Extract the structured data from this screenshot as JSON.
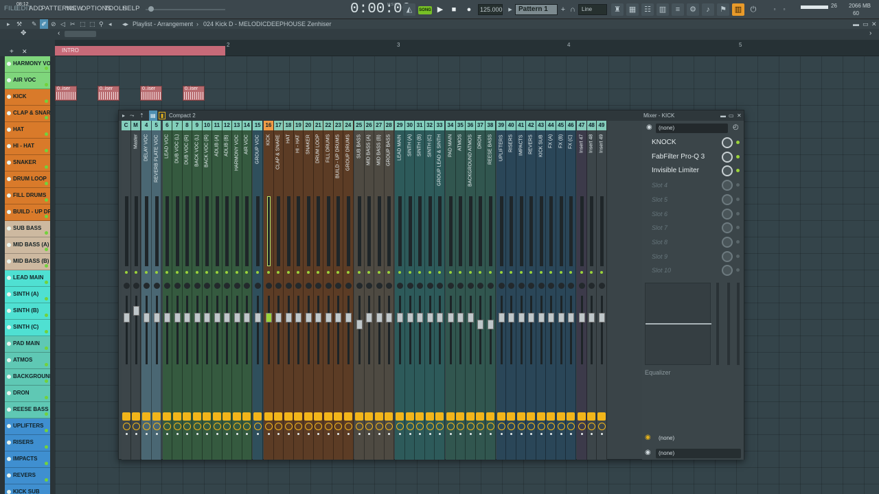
{
  "topbar": {
    "menus": [
      "FILE",
      "EDIT",
      "ADD",
      "PATTERNS",
      "VIEW",
      "OPTIONS",
      "TOOLS",
      "HELP"
    ],
    "time_small": "08:12",
    "time_display": "0:00:00",
    "time_format": "M:S:CS",
    "song_label": "SONG",
    "tempo": "125.000",
    "pattern": "Pattern 1",
    "snap": "Line",
    "ram": "2066 MB",
    "cpu_a": "26",
    "cpu_b": "60"
  },
  "crumb": {
    "title": "Playlist - Arrangement",
    "sep": "›",
    "item": "024 Kick D - MELODICDEEPHOUSE Zenhiser"
  },
  "timeline": {
    "bar_numbers": [
      "2",
      "3",
      "4",
      "5"
    ],
    "marker": "INTRO"
  },
  "tracks": [
    {
      "name": "HARMONY VOC",
      "color": "#7fd67c"
    },
    {
      "name": "AIR VOC",
      "color": "#7fd67c"
    },
    {
      "name": "KICK",
      "color": "#d97a2a"
    },
    {
      "name": "CLAP & SNARE",
      "color": "#d97a2a"
    },
    {
      "name": "HAT",
      "color": "#d97a2a"
    },
    {
      "name": "HI - HAT",
      "color": "#d97a2a"
    },
    {
      "name": "SNAKER",
      "color": "#d97a2a"
    },
    {
      "name": "DRUM LOOP",
      "color": "#d97a2a"
    },
    {
      "name": "FILL DRUMS",
      "color": "#d97a2a"
    },
    {
      "name": "BUILD - UP DR..",
      "color": "#d97a2a"
    },
    {
      "name": "SUB BASS",
      "color": "#cdb9a0"
    },
    {
      "name": "MID BASS (A)",
      "color": "#cdb9a0"
    },
    {
      "name": "MID BASS (B)",
      "color": "#cdb9a0"
    },
    {
      "name": "LEAD MAIN",
      "color": "#4fe0d2"
    },
    {
      "name": "SINTH (A)",
      "color": "#4fe0d2"
    },
    {
      "name": "SINTH (B)",
      "color": "#4fe0d2"
    },
    {
      "name": "SINTH (C)",
      "color": "#4fe0d2"
    },
    {
      "name": "PAD MAIN",
      "color": "#5fc8b4"
    },
    {
      "name": "ATMOS",
      "color": "#5fc8b4"
    },
    {
      "name": "BACKGROUND..",
      "color": "#5fc8b4"
    },
    {
      "name": "DRON",
      "color": "#5fc8b4"
    },
    {
      "name": "REESE BASS",
      "color": "#5fc8b4"
    },
    {
      "name": "UPLIFTERS",
      "color": "#3f8fd0"
    },
    {
      "name": "RISERS",
      "color": "#3f8fd0"
    },
    {
      "name": "IMPACTS",
      "color": "#3f8fd0"
    },
    {
      "name": "REVERS",
      "color": "#3f8fd0"
    },
    {
      "name": "KICK SUB",
      "color": "#3f8fd0"
    }
  ],
  "clips": [
    {
      "label": "0..iser"
    },
    {
      "label": "0..iser"
    },
    {
      "label": "0..iser"
    },
    {
      "label": "0..iser"
    }
  ],
  "mixer": {
    "view": "Compact 2",
    "title": "Mixer - KICK",
    "strips": [
      {
        "num": "C",
        "name": "",
        "color": "#3c4549"
      },
      {
        "num": "M",
        "name": "Master",
        "color": "#3c4549"
      },
      {
        "num": "4",
        "name": "DELAY VOC",
        "color": "#4a6773"
      },
      {
        "num": "5",
        "name": "REVERB PLATE VOC",
        "color": "#4a6773"
      },
      {
        "num": "6",
        "name": "LEAD VOC",
        "color": "#355a3f"
      },
      {
        "num": "7",
        "name": "DUB VOC (L)",
        "color": "#355a3f"
      },
      {
        "num": "8",
        "name": "DUB VOC (R)",
        "color": "#355a3f"
      },
      {
        "num": "9",
        "name": "BACK VOC (L)",
        "color": "#355a3f"
      },
      {
        "num": "10",
        "name": "BACK VOC (R)",
        "color": "#355a3f"
      },
      {
        "num": "11",
        "name": "ADLIB (A)",
        "color": "#355a3f"
      },
      {
        "num": "12",
        "name": "ADLIB (B)",
        "color": "#355a3f"
      },
      {
        "num": "13",
        "name": "HARMONY VOC",
        "color": "#355a3f"
      },
      {
        "num": "14",
        "name": "AIR VOC",
        "color": "#355a3f"
      },
      {
        "num": "15",
        "name": "GROUP VOC",
        "color": "#2f4f5c"
      },
      {
        "num": "16",
        "name": "KICK",
        "color": "#5c3c25"
      },
      {
        "num": "17",
        "name": "CLAP & SNARE",
        "color": "#5c3c25"
      },
      {
        "num": "18",
        "name": "HAT",
        "color": "#5c3c25"
      },
      {
        "num": "19",
        "name": "HI - HAT",
        "color": "#5c3c25"
      },
      {
        "num": "20",
        "name": "SNAKER",
        "color": "#5c3c25"
      },
      {
        "num": "21",
        "name": "DRUM LOOP",
        "color": "#5c3c25"
      },
      {
        "num": "22",
        "name": "FILL DRUMS",
        "color": "#5c3c25"
      },
      {
        "num": "23",
        "name": "BUILD - UP DRUMS",
        "color": "#5c3c25"
      },
      {
        "num": "24",
        "name": "GROUP DRUMS",
        "color": "#5c3c25"
      },
      {
        "num": "25",
        "name": "SUB BASS",
        "color": "#4e4a42"
      },
      {
        "num": "26",
        "name": "MID BASS (A)",
        "color": "#4e4a42"
      },
      {
        "num": "27",
        "name": "MID BASS (B)",
        "color": "#4e4a42"
      },
      {
        "num": "28",
        "name": "GROUP BASS",
        "color": "#4e4a42"
      },
      {
        "num": "29",
        "name": "LEAD MAIN",
        "color": "#2d5a5a"
      },
      {
        "num": "30",
        "name": "SINTH (A)",
        "color": "#2d5a5a"
      },
      {
        "num": "31",
        "name": "SINTH (B)",
        "color": "#2d5a5a"
      },
      {
        "num": "32",
        "name": "SINTH (C)",
        "color": "#2d5a5a"
      },
      {
        "num": "33",
        "name": "GROUP LEAD & SINTH",
        "color": "#2d5a5a"
      },
      {
        "num": "34",
        "name": "PAD MAIN",
        "color": "#31564f"
      },
      {
        "num": "35",
        "name": "ATMOS",
        "color": "#31564f"
      },
      {
        "num": "36",
        "name": "BACKGROUND ATMOS",
        "color": "#31564f"
      },
      {
        "num": "37",
        "name": "DRON",
        "color": "#31564f"
      },
      {
        "num": "38",
        "name": "REESE BASS",
        "color": "#31564f"
      },
      {
        "num": "39",
        "name": "UPLIFTERS",
        "color": "#2a4658"
      },
      {
        "num": "40",
        "name": "RISERS",
        "color": "#2a4658"
      },
      {
        "num": "41",
        "name": "IMPACTS",
        "color": "#2a4658"
      },
      {
        "num": "42",
        "name": "REVERS",
        "color": "#2a4658"
      },
      {
        "num": "43",
        "name": "KICK SUB",
        "color": "#2a4658"
      },
      {
        "num": "44",
        "name": "FX (A)",
        "color": "#2a4658"
      },
      {
        "num": "45",
        "name": "FX (B)",
        "color": "#2a4658"
      },
      {
        "num": "46",
        "name": "FX (C)",
        "color": "#2a4658"
      },
      {
        "num": "47",
        "name": "Insert 47",
        "color": "#3c3a4a"
      },
      {
        "num": "48",
        "name": "Insert 48",
        "color": "#3c4549"
      },
      {
        "num": "49",
        "name": "Insert 49",
        "color": "#3c4549"
      }
    ],
    "fx": {
      "preset": "(none)",
      "slots": [
        {
          "name": "KNOCK",
          "active": true
        },
        {
          "name": "FabFilter Pro-Q 3",
          "active": true
        },
        {
          "name": "Invisible Limiter",
          "active": true
        },
        {
          "name": "Slot 4",
          "active": false
        },
        {
          "name": "Slot 5",
          "active": false
        },
        {
          "name": "Slot 6",
          "active": false
        },
        {
          "name": "Slot 7",
          "active": false
        },
        {
          "name": "Slot 8",
          "active": false
        },
        {
          "name": "Slot 9",
          "active": false
        },
        {
          "name": "Slot 10",
          "active": false
        }
      ],
      "eq_label": "Equalizer",
      "out_a": "(none)",
      "out_b": "(none)"
    }
  }
}
